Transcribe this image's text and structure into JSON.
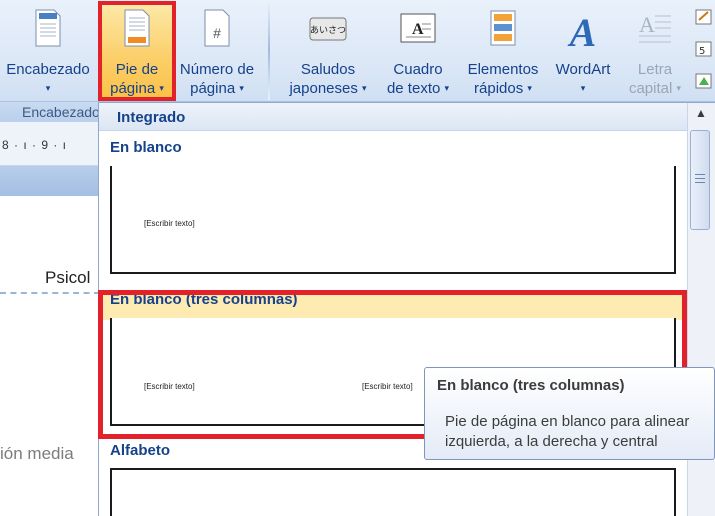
{
  "ribbon": {
    "buttons": {
      "encabezado": {
        "line1": "Encabezado",
        "arrow": "▾"
      },
      "pie": {
        "line1": "Pie de",
        "line2": "página",
        "arrow": "▾"
      },
      "numero": {
        "line1": "Número de",
        "line2": "página",
        "arrow": "▾"
      },
      "saludos": {
        "line1": "Saludos",
        "line2": "japoneses",
        "arrow": "▾"
      },
      "cuadro": {
        "line1": "Cuadro",
        "line2": "de texto",
        "arrow": "▾"
      },
      "elementos": {
        "line1": "Elementos",
        "line2": "rápidos",
        "arrow": "▾"
      },
      "wordart": {
        "line1": "WordArt",
        "arrow": "▾"
      },
      "letra": {
        "line1": "Letra",
        "line2": "capital",
        "arrow": "▾"
      }
    },
    "group_label": "Encabezado",
    "saludos_icon_text": "あいさつ",
    "cuadro_icon_text": "A",
    "wordart_icon_text": "A",
    "letra_icon_text": "A",
    "numero_icon_text": "#"
  },
  "document": {
    "ruler_text": "8 · ı · 9 · ı",
    "text1": "Psicol",
    "text2": "ión media"
  },
  "gallery": {
    "header": "Integrado",
    "sections": [
      {
        "label": "En blanco",
        "placeholders": [
          "[Escribir texto]"
        ]
      },
      {
        "label": "En blanco (tres columnas)",
        "placeholders": [
          "[Escribir texto]",
          "[Escribir texto]"
        ]
      },
      {
        "label": "Alfabeto",
        "placeholders": []
      }
    ]
  },
  "tooltip": {
    "title": "En blanco (tres columnas)",
    "line1": "Pie de página en blanco para alinear",
    "line2": "izquierda, a la derecha y central"
  },
  "colors": {
    "accent_text": "#15428b",
    "highlight": "#fbd06c",
    "selection_border": "#e3212a"
  }
}
